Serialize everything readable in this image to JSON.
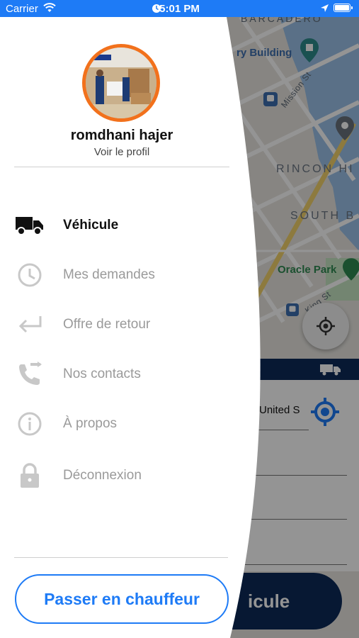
{
  "status_bar": {
    "carrier": "Carrier",
    "time": "5:01 PM",
    "background_color": "#1e7bf6"
  },
  "map": {
    "labels": {
      "embarcadero": "BARCADERO",
      "ferry_building": "ry Building",
      "mission_st": "Mission St",
      "rincon_hill": "RINCON HI",
      "south_beach": "SOUTH B",
      "oracle_park": "Oracle Park",
      "king_st": "King St"
    }
  },
  "background_card": {
    "address_value": "United S",
    "button_label": "icule",
    "accent_color": "#0d2a59"
  },
  "drawer": {
    "profile": {
      "name": "romdhani hajer",
      "view_profile": "Voir le profil"
    },
    "menu": [
      {
        "label": "Véhicule",
        "icon": "truck-icon",
        "active": true
      },
      {
        "label": "Mes demandes",
        "icon": "clock-icon",
        "active": false
      },
      {
        "label": "Offre de retour",
        "icon": "return-arrow-icon",
        "active": false
      },
      {
        "label": "Nos contacts",
        "icon": "phone-forward-icon",
        "active": false
      },
      {
        "label": "À propos",
        "icon": "info-icon",
        "active": false
      },
      {
        "label": "Déconnexion",
        "icon": "lock-icon",
        "active": false
      }
    ],
    "driver_button_label": "Passer en chauffeur",
    "accent_color": "#1e7bf6",
    "avatar_border_color": "#f2711c"
  }
}
